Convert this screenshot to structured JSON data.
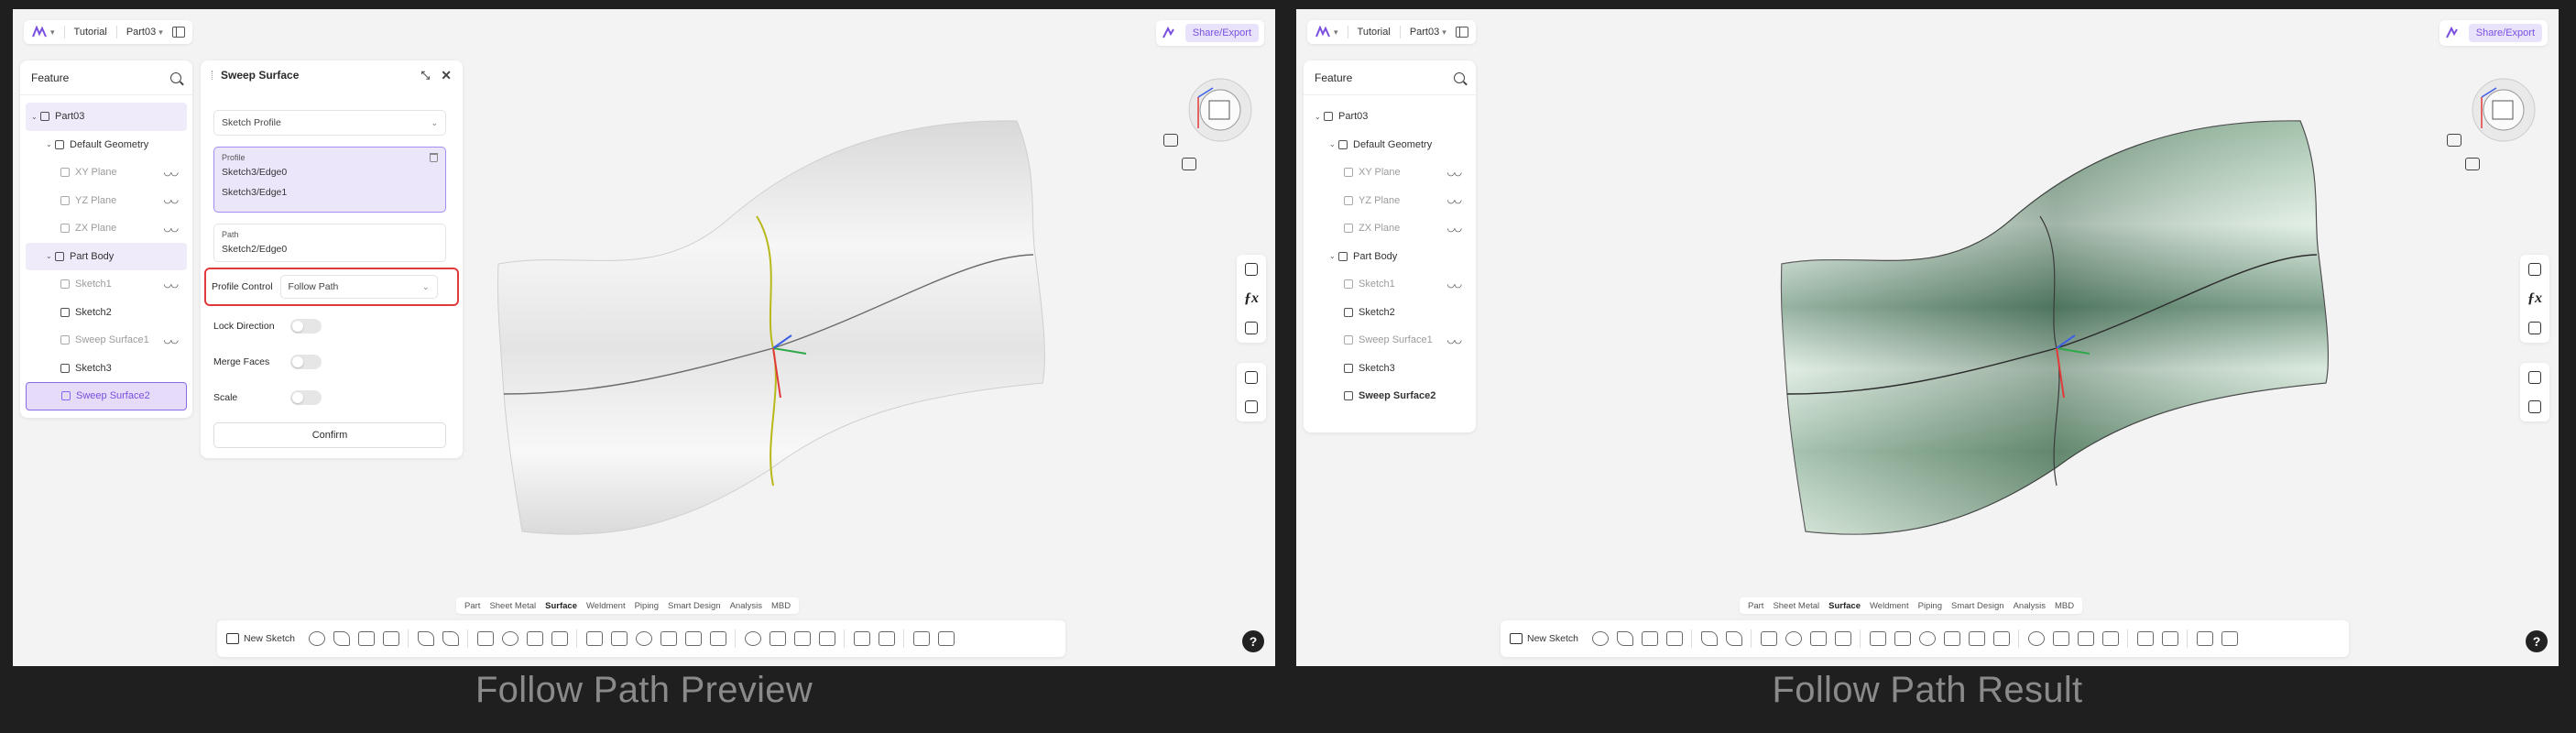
{
  "captions": {
    "left": "Follow Path  Preview",
    "right": "Follow Path  Result"
  },
  "topbar": {
    "tutorial": "Tutorial",
    "part": "Part03",
    "share": "Share/Export"
  },
  "feature": {
    "title": "Feature",
    "tree": [
      {
        "label": "Part03",
        "level": 0
      },
      {
        "label": "Default Geometry",
        "level": 1
      },
      {
        "label": "XY Plane",
        "level": 2
      },
      {
        "label": "YZ Plane",
        "level": 2
      },
      {
        "label": "ZX Plane",
        "level": 2
      },
      {
        "label": "Part Body",
        "level": 1
      },
      {
        "label": "Sketch1",
        "level": 2
      },
      {
        "label": "Sketch2",
        "level": 2
      },
      {
        "label": "Sweep Surface1",
        "level": 2
      },
      {
        "label": "Sketch3",
        "level": 2
      },
      {
        "label": "Sweep Surface2",
        "level": 2
      }
    ]
  },
  "sweep": {
    "title": "Sweep Surface",
    "type_value": "Sketch Profile",
    "profile_label": "Profile",
    "profile_items": [
      "Sketch3/Edge0",
      "Sketch3/Edge1"
    ],
    "path_label": "Path",
    "path_value": "Sketch2/Edge0",
    "profile_control_label": "Profile Control",
    "profile_control_value": "Follow Path",
    "lock_direction": "Lock Direction",
    "merge_faces": "Merge Faces",
    "scale": "Scale",
    "confirm": "Confirm"
  },
  "bottom_tabs": [
    "Part",
    "Sheet Metal",
    "Surface",
    "Weldment",
    "Piping",
    "Smart Design",
    "Analysis",
    "MBD"
  ],
  "active_tab": "Surface",
  "toolbar": {
    "new_sketch": "New Sketch"
  },
  "help": "?"
}
